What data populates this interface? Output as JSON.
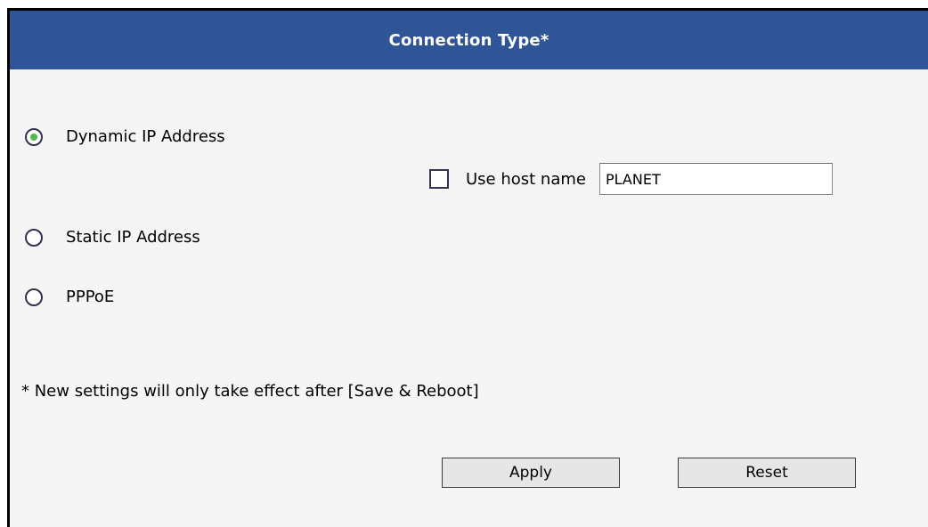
{
  "header": {
    "title": "Connection Type*"
  },
  "connection_options": [
    {
      "label": "Dynamic IP Address",
      "selected": true
    },
    {
      "label": "Static IP Address",
      "selected": false
    },
    {
      "label": "PPPoE",
      "selected": false
    }
  ],
  "host_name": {
    "label": "Use host name",
    "checked": false,
    "value": "PLANET"
  },
  "note": "* New settings will only take effect after [Save & Reboot]",
  "buttons": {
    "apply": "Apply",
    "reset": "Reset"
  },
  "colors": {
    "header_bg": "#2f5597",
    "panel_bg": "#f5f5f5",
    "radio_selected": "#4dbb4d"
  }
}
